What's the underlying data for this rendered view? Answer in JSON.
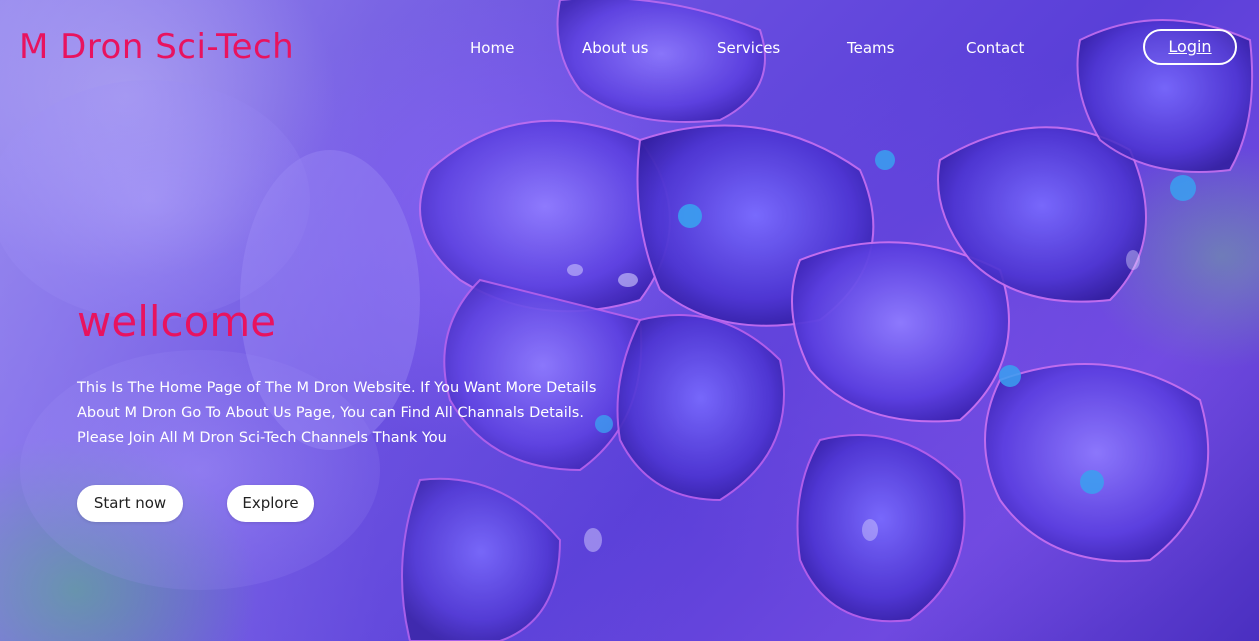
{
  "brand": {
    "logo_text": "M Dron Sci-Tech",
    "accent_color": "#e8135f"
  },
  "nav": {
    "items": [
      {
        "label": "Home"
      },
      {
        "label": "About us"
      },
      {
        "label": "Services"
      },
      {
        "label": "Teams"
      },
      {
        "label": "Contact"
      }
    ],
    "login_label": "Login"
  },
  "hero": {
    "title": "wellcome",
    "description_lines": [
      "This Is The Home Page of The M Dron Website. If You Want More Details",
      "About M Dron Go To About Us Page, You can Find All Channals Details.",
      "Please Join All M Dron Sci-Tech Channels Thank You"
    ],
    "buttons": {
      "start_label": "Start now",
      "explore_label": "Explore"
    },
    "background_image": "purple hydrangea flowers with water droplets"
  }
}
